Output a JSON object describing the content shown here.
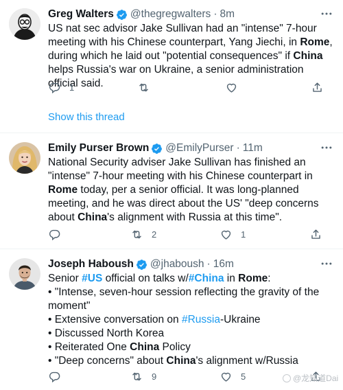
{
  "tweets": [
    {
      "name": "Greg Walters",
      "handle": "@thegregwalters",
      "time": "8m",
      "body_html": "US nat sec advisor Jake Sullivan had an \"intense\" 7-hour meeting with his Chinese counterpart, Yang Jiechi, in <b>Rome</b>, during which he laid out \"potential consequences\" if <b>China</b> helps Russia's war on Ukraine, a senior administration official said.",
      "reply_count": "1",
      "retweet_count": "",
      "like_count": ""
    },
    {
      "name": "Emily Purser Brown",
      "handle": "@EmilyPurser",
      "time": "11m",
      "body_html": "National Security adviser Jake Sullivan has finished an \"intense\" 7-hour meeting with his Chinese counterpart in <b>Rome</b> today, per a senior official. It was long-planned meeting, and he was direct about the US' \"deep concerns about <b>China</b>'s alignment with Russia at this time\".",
      "reply_count": "",
      "retweet_count": "2",
      "like_count": "1"
    },
    {
      "name": "Joseph Haboush",
      "handle": "@jhaboush",
      "time": "16m",
      "body_html": "Senior <span class=\"hashtag\"><b>#US</b></span> official on talks w/<span class=\"hashtag\"><b>#China</b></span> in <b>Rome</b>:",
      "bullets": [
        "• \"Intense, seven-hour session reflecting the gravity of the moment\"",
        "• Extensive conversation on <span class=\"hashtag\">#Russia</span>-Ukraine",
        "• Discussed North Korea",
        "• Reiterated One <b>China</b> Policy",
        "• \"Deep concerns\" about <b>China</b>'s alignment w/Russia"
      ],
      "reply_count": "",
      "retweet_count": "9",
      "like_count": "5"
    }
  ],
  "show_thread_label": "Show this thread",
  "watermark": "@龙知道Dai",
  "colors": {
    "accent": "#1d9bf0",
    "muted": "#536471",
    "text": "#0f1419",
    "divider": "#eff3f4"
  },
  "icons": [
    "reply-icon",
    "retweet-icon",
    "like-icon",
    "share-icon",
    "verified-badge-icon",
    "more-icon"
  ]
}
